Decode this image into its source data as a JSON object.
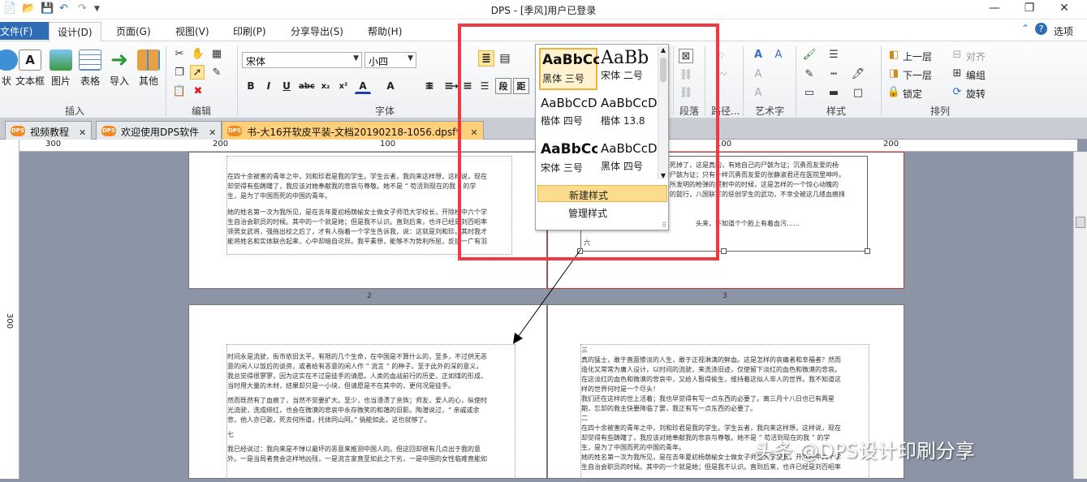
{
  "window": {
    "title": "DPS - [季风]用户已登录"
  },
  "quick_access": [
    "save",
    "open",
    "undo",
    "redo"
  ],
  "menu": {
    "file": "文件(F)",
    "tabs": [
      "设计(D)",
      "页面(G)",
      "视图(V)",
      "印刷(P)",
      "分享导出(S)",
      "帮助(H)"
    ],
    "options": "选项"
  },
  "ribbon": {
    "insert": {
      "label": "插入",
      "buttons": [
        "状",
        "文本框",
        "图片",
        "表格",
        "导入",
        "其他"
      ]
    },
    "edit": {
      "label": "编辑"
    },
    "font": {
      "label": "字体",
      "family": "宋体",
      "size": "小四"
    },
    "para": {
      "label": "段落"
    },
    "path": {
      "label": "路径..."
    },
    "art": {
      "label": "艺术字"
    },
    "style": {
      "label": "样式"
    },
    "arrange": {
      "label": "排列",
      "up": "上一层",
      "down": "下一层",
      "lock": "锁定",
      "align": "对齐",
      "group": "编组",
      "rotate": "旋转",
      "para_btn1": "段",
      "para_btn2": "距"
    }
  },
  "doc_tabs": [
    {
      "label": "视频教程"
    },
    {
      "label": "欢迎使用DPS软件"
    },
    {
      "label": "书-大16开软皮平装-文档20190218-1056.dpsf*"
    }
  ],
  "ruler": {
    "h": [
      "300",
      "200",
      "100",
      "0",
      "100",
      "200"
    ],
    "v": [
      "300"
    ]
  },
  "gallery": {
    "styles": [
      {
        "sample": "AaBbCc",
        "font": "黑体",
        "size": "三号"
      },
      {
        "sample": "AaBb",
        "font": "宋体",
        "size": "二号"
      },
      {
        "sample": "AaBbCcD",
        "font": "楷体",
        "size": "四号"
      },
      {
        "sample": "AaBbCcD",
        "font": "楷体",
        "size": "13.8"
      },
      {
        "sample": "AaBbCc",
        "font": "宋体",
        "size": "三号"
      },
      {
        "sample": "AaBbCcD",
        "font": "黑体",
        "size": "四号"
      }
    ],
    "new_style": "新建样式",
    "manage_style": "管理样式"
  },
  "pages": {
    "p1_text": [
      "在四十余被害的青年之中，刘和珍君是我的学生。学生云者，我向来这样想，这样说，现在",
      "却觉得有些踌躇了，我应该对她奉献我的悲哀与尊敬。她不是 “ 苟活到现在的我 ” 的学",
      "生，是为了中国而死的中国的青年。",
      "她的姓名第一次为我所见，是在去年夏初杨荫榆女士做女子师范大学校长，开除校中六个学",
      "生自治会职员的时候。其中的一个就是她；但是我不认识。直到后来，也许已经是刘百昭率",
      "领男女武将，强拖出校之后了，才有人指着一个学生告诉我，说：这就是刘和珍。其时我才",
      "能将姓名和实体联合起来，心中却暗自诧异。我平素想，能够不为势利所屈，反抗一广有羽"
    ],
    "p2_text": [
      "是死掉了，这是真的，有她自己的尸骸为证；沉勇而友爱的杨",
      "的尸骸为证；只有一样沉勇而友爱的张静淑君还在医院里呻吟。",
      "人所发明的枪弹的攒射中的时候，这是怎样的一个惊心动魄的",
      "者的懿行，八国联军的惩创学生的武功，不幸全被这几缕血痕抹",
      "头来，不知道个个脸上有着血污……"
    ],
    "p3_text": [
      "时间永是流驶，街市依旧太平，有限的几个生命，在中国是不算什么的，至多，不过供无恶",
      "意的闲人以饭后的谈资，或者给有恶意的闲人作 “ 流言 ” 的种子。至于此外的深的意义，",
      "我总觉得很寥寥，因为这实在不过是徒手的请愿。人类的血战前行的历史，正如煤的形成，",
      "当时用大量的木材，结果却只是一小块，但请愿是不在其中的，更何况是徒手。",
      "然而既然有了血痕了，当然不觉要扩大。至少，也当浸渍了亲族；师友，爱人的心，纵使时",
      "光流驶，洗成绯红，也会在微漠的悲哀中永存微笑的和蔼的旧影。陶潜说过，“ 亲戚或余",
      "悲，他人亦已歌，死去何所道，托体同山阿。” 倘能如此，这也就够了。",
      "七",
      "我已经说过：我向来是不惮以最坏的恶意来推测中国人的。但这回却很有几点出于我的意",
      "外。一是当局者竟会这样地凶残，一是流言家竟至如此之下劣，一是中国的女性临难竟能如"
    ],
    "p4_text": [
      "三",
      "真的猛士，敢于直面惨淡的人生，敢于正视淋漓的鲜血。这是怎样的哀痛者和幸福者？然而",
      "造化又常常为庸人设计，以时间的流驶，来洗涤旧迹，仅使留下淡红的血色和微漠的悲哀。",
      "在这淡红的血色和微漠的悲哀中，又给人暂得偷生，维持着这似人非人的世界。我不知道这",
      "样的世界何时是一个尽头！",
      "我们还在这样的世上活着；我也早觉得有写一点东西的必要了。离三月十八日也已有两星",
      "期，忘却的救主快要降临了罢，我正有写一点东西的必要了。",
      "二",
      "在四十余被害的青年之中，刘和珍君是我的学生。学生云者，我向来这样想，这样说，现在",
      "却觉得有些踌躇了，我应该对她奉献我的悲哀与尊敬。她不是 “ 苟活到现在的我 ” 的学",
      "生，是为了中国而死的中国的青年。",
      "她的姓名第一次为我所见，是在去年夏初杨荫榆女士做女子师范大学校长，开除校中六个学",
      "生自治会职员的时候。其中的一个就是她；但是我不认识。直到后来，也许已经是刘百昭率"
    ],
    "p2_small": "六",
    "page_nums": [
      "2",
      "3"
    ]
  },
  "watermark": "头条 @DPS设计印刷分享",
  "colors": {
    "accent": "#2f6cb8",
    "highlight": "#ee3a43",
    "active_tab": "#ffd079"
  }
}
